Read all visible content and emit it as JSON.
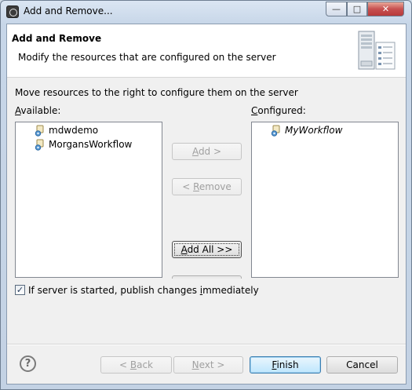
{
  "window": {
    "title": "Add and Remove...",
    "minimize_icon": "minimize-icon",
    "maximize_icon": "maximize-icon",
    "close_icon": "close-icon"
  },
  "header": {
    "title": "Add and Remove",
    "description": "Modify the resources that are configured on the server",
    "icon": "server-icon"
  },
  "instruction": "Move resources to the right to configure them on the server",
  "available": {
    "label_prefix": "",
    "label_mnemonic": "A",
    "label_rest": "vailable:",
    "items": [
      {
        "label": "mdwdemo",
        "icon": "project-resource-icon"
      },
      {
        "label": "MorgansWorkflow",
        "icon": "project-resource-icon"
      }
    ]
  },
  "configured": {
    "label_prefix": "",
    "label_mnemonic": "C",
    "label_rest": "onfigured:",
    "items": [
      {
        "label": "MyWorkflow",
        "icon": "project-resource-icon"
      }
    ]
  },
  "buttons": {
    "add": {
      "mnemonic": "A",
      "rest": "dd >"
    },
    "remove": {
      "prefix": "< ",
      "mnemonic": "R",
      "rest": "emove"
    },
    "add_all": {
      "mnemonic": "A",
      "rest": "dd All >>"
    },
    "back": {
      "prefix": "< ",
      "mnemonic": "B",
      "rest": "ack"
    },
    "next": {
      "mnemonic": "N",
      "rest": "ext >"
    },
    "finish": {
      "mnemonic": "F",
      "rest": "inish"
    },
    "cancel": {
      "label": "Cancel"
    }
  },
  "publish_checkbox": {
    "checked": true,
    "label_prefix": "If server is started, publish changes ",
    "label_mnemonic": "i",
    "label_rest": "mmediately"
  },
  "help": {
    "glyph": "?",
    "icon": "help-icon"
  }
}
